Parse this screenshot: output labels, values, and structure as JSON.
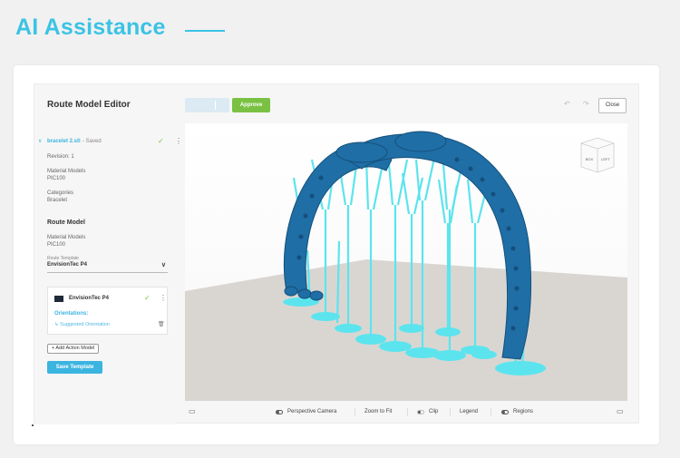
{
  "hero": {
    "title": "AI Assistance"
  },
  "editor": {
    "title": "Route Model Editor",
    "file": {
      "name": "bracelet 2.stl",
      "status": "- Saved"
    },
    "revision": "Revision: 1",
    "material_models_label": "Material Models",
    "material_models_value": "PIC100",
    "categories_label": "Categories",
    "categories_value": "Bracelet",
    "route_model_heading": "Route Model",
    "route_material_label": "Material Models",
    "route_material_value": "PIC100",
    "route_template_label": "Route Template",
    "route_template_value": "EnvisionTec P4",
    "printer": {
      "name": "EnvisionTec P4",
      "orientations_label": "Orientations:",
      "orientation_item": "↳ Suggested Orientation"
    },
    "add_action_label": "+ Add Action Model",
    "save_template_label": "Save Template"
  },
  "toolbar": {
    "approve_label": "Approve",
    "close_label": "Close"
  },
  "viewcube": {
    "face_left": "BOX",
    "face_right": "LEFT"
  },
  "bottom_bar": {
    "perspective_label": "Perspective Camera",
    "zoom_label": "Zoom to Fit",
    "clip_label": "Clip",
    "legend_label": "Legend",
    "regions_label": "Regions"
  },
  "colors": {
    "accent": "#3bc3e4",
    "approve": "#7ac143",
    "model": "#1f6ea6",
    "supports": "#5ce4ee",
    "floor": "#d9d6d2"
  }
}
